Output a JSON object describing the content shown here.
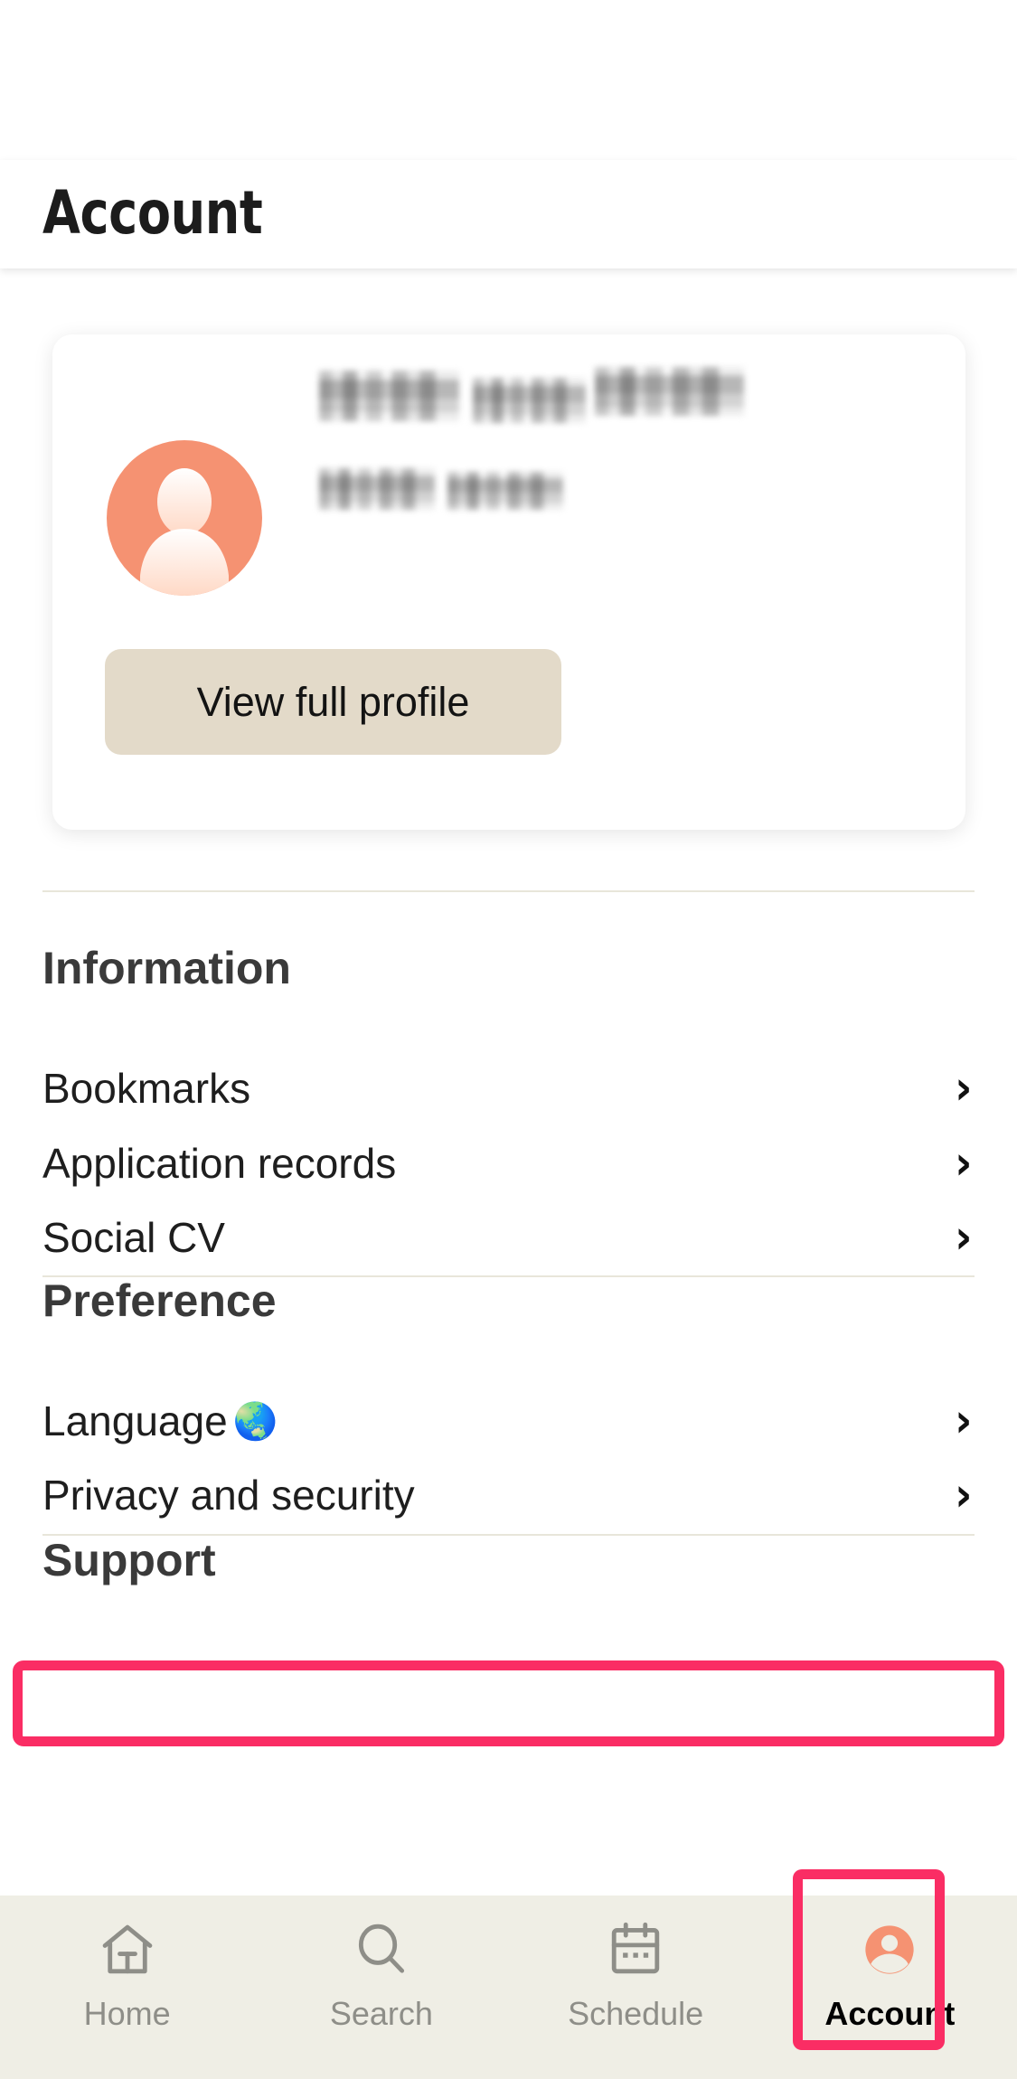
{
  "header": {
    "title": "Account"
  },
  "profile": {
    "avatar_icon": "person-avatar-icon",
    "avatar_color": "#F59272",
    "name_redacted": true,
    "email_redacted": true,
    "view_full_profile_label": "View full profile",
    "view_full_profile_color": "#E3DAC9"
  },
  "sections": [
    {
      "heading": "Information",
      "items": [
        {
          "label": "Bookmarks",
          "emoji": "",
          "chevron": "chevron-right-icon"
        },
        {
          "label": "Application records",
          "emoji": "",
          "chevron": "chevron-right-icon"
        },
        {
          "label": "Social CV",
          "emoji": "",
          "chevron": "chevron-right-icon"
        }
      ]
    },
    {
      "heading": "Preference",
      "items": [
        {
          "label": "Language",
          "emoji": "🌏",
          "chevron": "chevron-right-icon"
        },
        {
          "label": "Privacy and security",
          "emoji": "",
          "chevron": "chevron-right-icon"
        }
      ]
    },
    {
      "heading": "Support",
      "items": []
    }
  ],
  "bottom_nav": {
    "items": [
      {
        "label": "Home",
        "icon": "home-icon",
        "active": false
      },
      {
        "label": "Search",
        "icon": "search-icon",
        "active": false
      },
      {
        "label": "Schedule",
        "icon": "calendar-icon",
        "active": false
      },
      {
        "label": "Account",
        "icon": "account-icon",
        "active": true
      }
    ],
    "inactive_color": "#8E8E88",
    "active_color": "#F59272",
    "background": "#EFEEE5"
  },
  "annotations": {
    "color": "#FA2D64",
    "targets": [
      "Privacy and security",
      "Account"
    ]
  }
}
